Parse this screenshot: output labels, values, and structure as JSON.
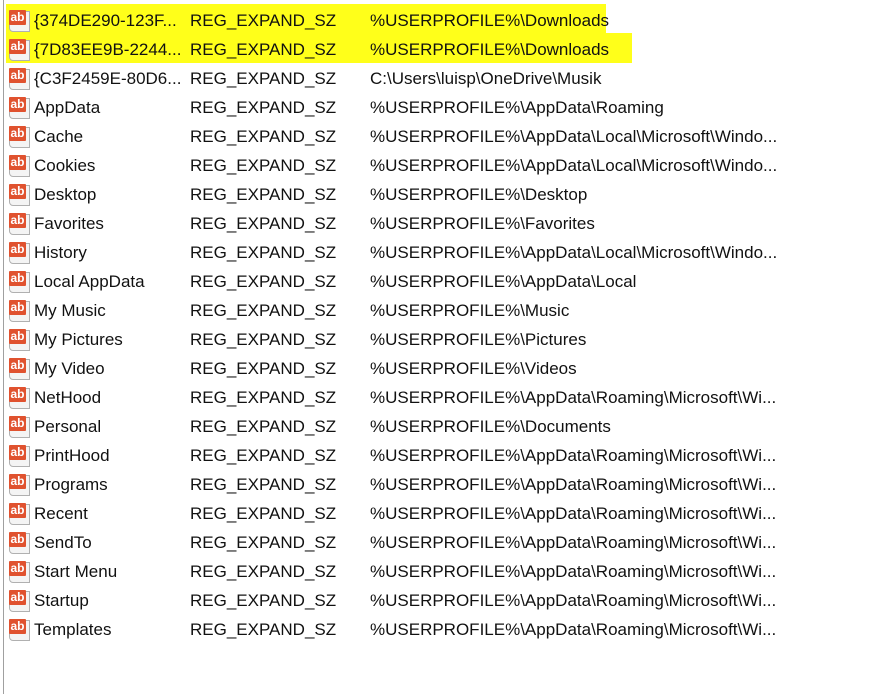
{
  "highlight_color": "#ffff1a",
  "icon": "reg-string-ab-icon",
  "icon_text": "ab",
  "rows": [
    {
      "name": "{374DE290-123F...",
      "type": "REG_EXPAND_SZ",
      "data": "%USERPROFILE%\\Downloads"
    },
    {
      "name": "{7D83EE9B-2244...",
      "type": "REG_EXPAND_SZ",
      "data": "%USERPROFILE%\\Downloads"
    },
    {
      "name": "{C3F2459E-80D6...",
      "type": "REG_EXPAND_SZ",
      "data": "C:\\Users\\luisp\\OneDrive\\Musik"
    },
    {
      "name": "AppData",
      "type": "REG_EXPAND_SZ",
      "data": "%USERPROFILE%\\AppData\\Roaming"
    },
    {
      "name": "Cache",
      "type": "REG_EXPAND_SZ",
      "data": "%USERPROFILE%\\AppData\\Local\\Microsoft\\Windo..."
    },
    {
      "name": "Cookies",
      "type": "REG_EXPAND_SZ",
      "data": "%USERPROFILE%\\AppData\\Local\\Microsoft\\Windo..."
    },
    {
      "name": "Desktop",
      "type": "REG_EXPAND_SZ",
      "data": "%USERPROFILE%\\Desktop"
    },
    {
      "name": "Favorites",
      "type": "REG_EXPAND_SZ",
      "data": "%USERPROFILE%\\Favorites"
    },
    {
      "name": "History",
      "type": "REG_EXPAND_SZ",
      "data": "%USERPROFILE%\\AppData\\Local\\Microsoft\\Windo..."
    },
    {
      "name": "Local AppData",
      "type": "REG_EXPAND_SZ",
      "data": "%USERPROFILE%\\AppData\\Local"
    },
    {
      "name": "My Music",
      "type": "REG_EXPAND_SZ",
      "data": "%USERPROFILE%\\Music"
    },
    {
      "name": "My Pictures",
      "type": "REG_EXPAND_SZ",
      "data": "%USERPROFILE%\\Pictures"
    },
    {
      "name": "My Video",
      "type": "REG_EXPAND_SZ",
      "data": "%USERPROFILE%\\Videos"
    },
    {
      "name": "NetHood",
      "type": "REG_EXPAND_SZ",
      "data": "%USERPROFILE%\\AppData\\Roaming\\Microsoft\\Wi..."
    },
    {
      "name": "Personal",
      "type": "REG_EXPAND_SZ",
      "data": "%USERPROFILE%\\Documents"
    },
    {
      "name": "PrintHood",
      "type": "REG_EXPAND_SZ",
      "data": "%USERPROFILE%\\AppData\\Roaming\\Microsoft\\Wi..."
    },
    {
      "name": "Programs",
      "type": "REG_EXPAND_SZ",
      "data": "%USERPROFILE%\\AppData\\Roaming\\Microsoft\\Wi..."
    },
    {
      "name": "Recent",
      "type": "REG_EXPAND_SZ",
      "data": "%USERPROFILE%\\AppData\\Roaming\\Microsoft\\Wi..."
    },
    {
      "name": "SendTo",
      "type": "REG_EXPAND_SZ",
      "data": "%USERPROFILE%\\AppData\\Roaming\\Microsoft\\Wi..."
    },
    {
      "name": "Start Menu",
      "type": "REG_EXPAND_SZ",
      "data": "%USERPROFILE%\\AppData\\Roaming\\Microsoft\\Wi..."
    },
    {
      "name": "Startup",
      "type": "REG_EXPAND_SZ",
      "data": "%USERPROFILE%\\AppData\\Roaming\\Microsoft\\Wi..."
    },
    {
      "name": "Templates",
      "type": "REG_EXPAND_SZ",
      "data": "%USERPROFILE%\\AppData\\Roaming\\Microsoft\\Wi..."
    }
  ]
}
